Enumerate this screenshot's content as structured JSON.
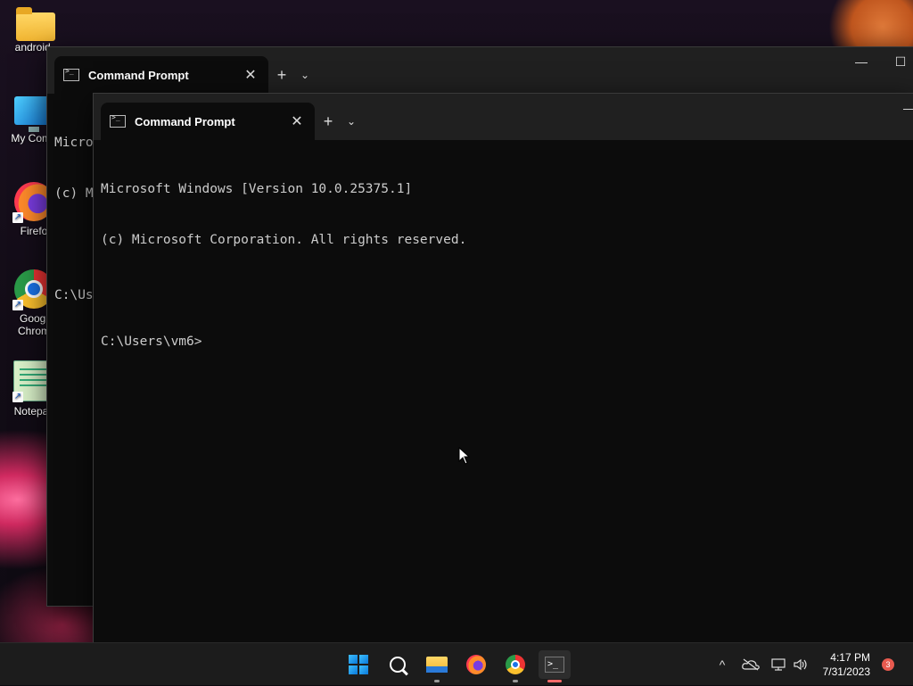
{
  "desktop": {
    "icons": [
      {
        "label": "android_",
        "icon": "folder-icon"
      },
      {
        "label": "My Comp",
        "icon": "monitor-icon"
      },
      {
        "label": "Firefo",
        "icon": "firefox-icon"
      },
      {
        "label": "Googl",
        "label2": "Chrom",
        "icon": "chrome-icon"
      },
      {
        "label": "Notepac",
        "icon": "notepad-icon"
      }
    ]
  },
  "window_back": {
    "tab_title": "Command Prompt",
    "new_tab": "+",
    "dropdown": "⌄",
    "minimize": "—",
    "maximize": "☐",
    "lines": [
      "Micro",
      "(c) M",
      "",
      "C:\\Us"
    ]
  },
  "window_front": {
    "tab_title": "Command Prompt",
    "close": "✕",
    "new_tab": "+",
    "dropdown": "⌄",
    "minimize": "—",
    "lines": [
      "Microsoft Windows [Version 10.0.25375.1]",
      "(c) Microsoft Corporation. All rights reserved.",
      "",
      "C:\\Users\\vm6>"
    ]
  },
  "taskbar": {
    "apps": [
      "start-icon",
      "search-icon",
      "file-explorer-icon",
      "firefox-icon",
      "chrome-icon",
      "terminal-icon"
    ],
    "tray": {
      "chevron": "^",
      "time": "4:17 PM",
      "date": "7/31/2023",
      "notifications": "3"
    }
  },
  "colors": {
    "console_bg": "#0c0c0c",
    "console_text": "#cccccc",
    "titlebar": "#202020",
    "taskbar": "#1c1c1c",
    "accent": "#0a78d8"
  }
}
